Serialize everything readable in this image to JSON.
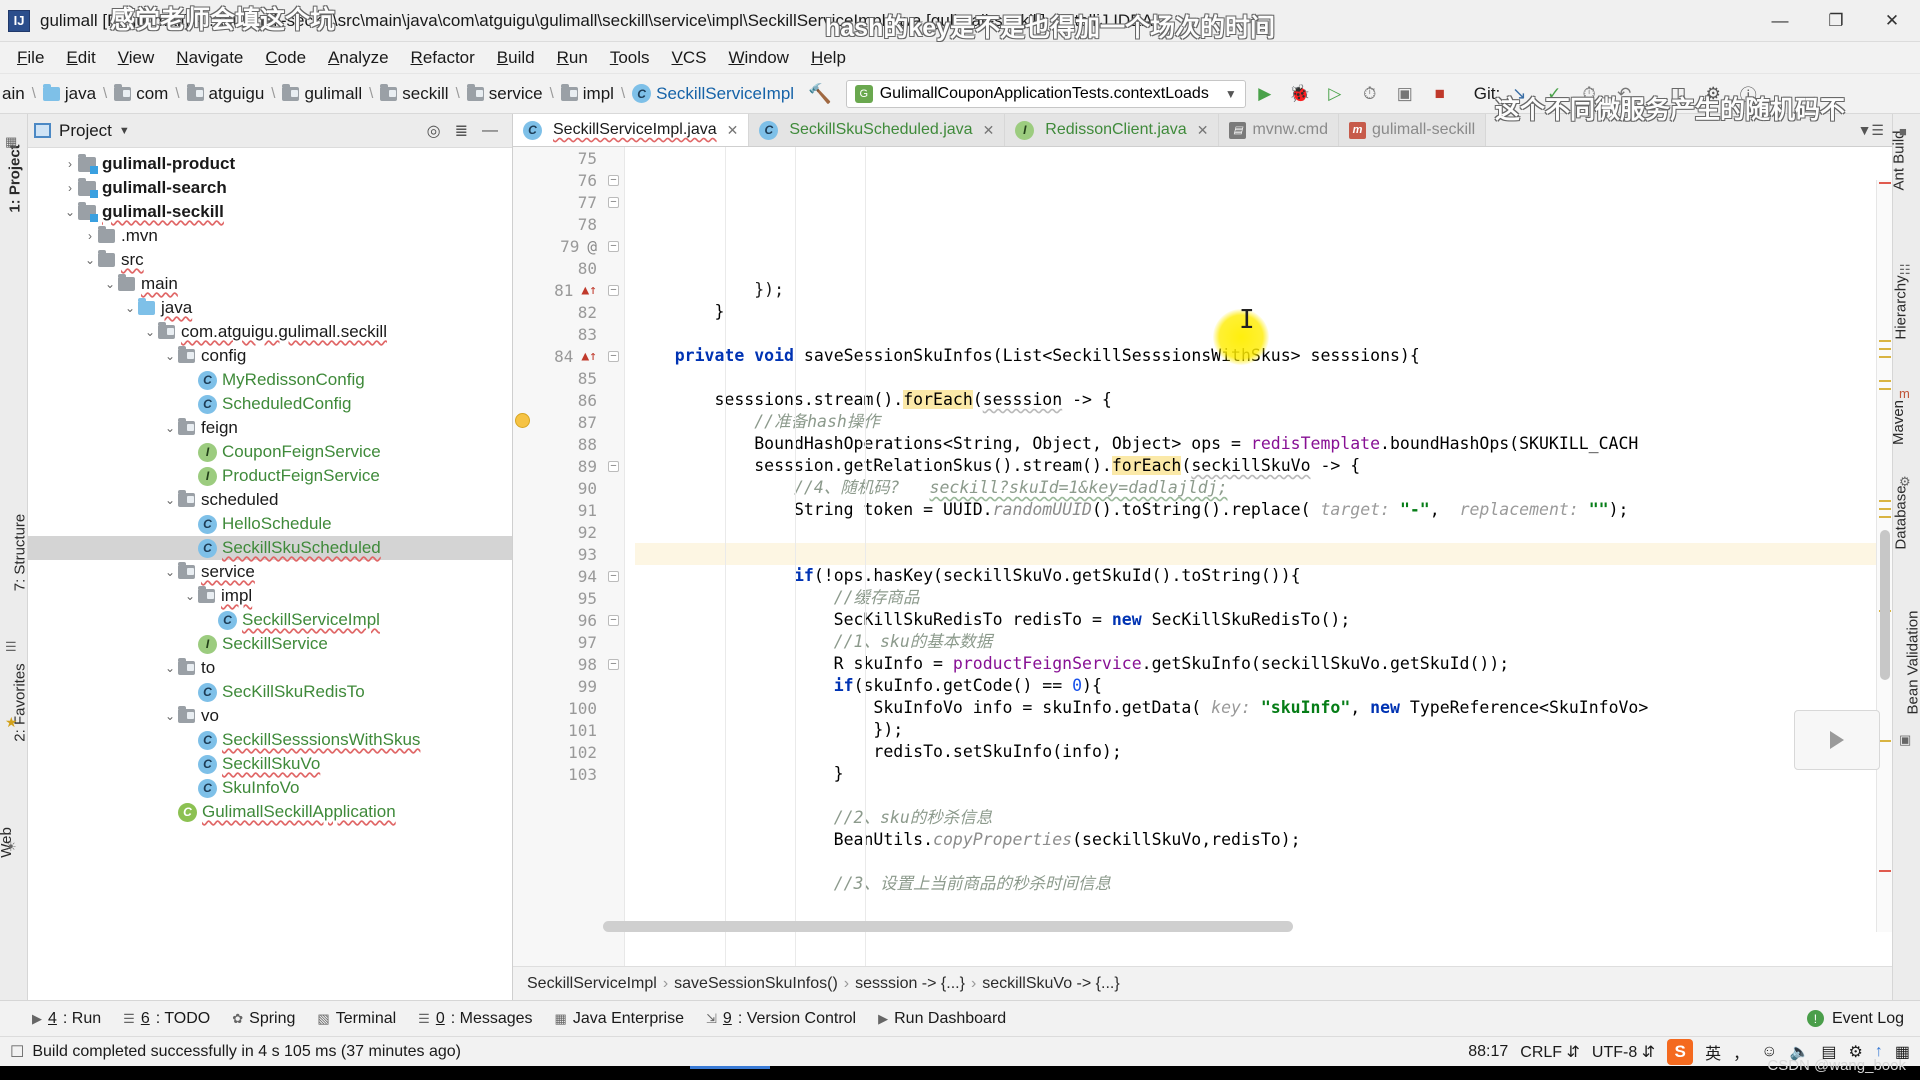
{
  "window": {
    "title": "gulimall [F:\\gulimall] - ...\\gulimall-seckill\\src\\main\\java\\com\\atguigu\\gulimall\\seckill\\service\\impl\\SeckillServiceImpl.java [gulimall-seckill] - IntelliJ IDEA",
    "app_icon": "IJ",
    "minimize": "—",
    "maximize": "❐",
    "close": "✕"
  },
  "overlay": {
    "line1": "感觉老师会填这个坑",
    "line2": "hash的key是不是也得加一个场次的时间",
    "line3": "这个不同微服务产生的随机码不",
    "watermark": "CSDN @wang_book"
  },
  "menu": [
    "File",
    "Edit",
    "View",
    "Navigate",
    "Code",
    "Analyze",
    "Refactor",
    "Build",
    "Run",
    "Tools",
    "VCS",
    "Window",
    "Help"
  ],
  "navbar": {
    "breadcrumbs": [
      {
        "label": "ain",
        "icon": "none"
      },
      {
        "label": "java",
        "icon": "folder-blue"
      },
      {
        "label": "com",
        "icon": "folder-grey"
      },
      {
        "label": "atguigu",
        "icon": "folder-grey"
      },
      {
        "label": "gulimall",
        "icon": "folder-grey"
      },
      {
        "label": "seckill",
        "icon": "folder-grey"
      },
      {
        "label": "service",
        "icon": "folder-grey"
      },
      {
        "label": "impl",
        "icon": "folder-grey"
      },
      {
        "label": "SeckillServiceImpl",
        "icon": "class"
      }
    ],
    "run_config": "GulimallCouponApplicationTests.contextLoads",
    "git_label": "Git:",
    "build_icon": "build-hammer-icon"
  },
  "left_strip": [
    "1: Project",
    "7: Structure",
    "2: Favorites",
    "Web"
  ],
  "right_strip": [
    "Ant Build",
    "Hierarchy",
    "Maven",
    "Database",
    "Bean Validation"
  ],
  "project_panel": {
    "title": "Project",
    "tree": [
      {
        "depth": 1,
        "arrow": "›",
        "icon": "module",
        "label": "gulimall-product",
        "style": "bold-dark",
        "selected": false
      },
      {
        "depth": 1,
        "arrow": "›",
        "icon": "module",
        "label": "gulimall-search",
        "style": "bold-dark",
        "selected": false
      },
      {
        "depth": 1,
        "arrow": "⌄",
        "icon": "module",
        "label": "gulimall-seckill",
        "style": "bold-dark-squiggle",
        "selected": false
      },
      {
        "depth": 2,
        "arrow": "›",
        "icon": "folder-grey",
        "label": ".mvn",
        "style": "dark",
        "selected": false
      },
      {
        "depth": 2,
        "arrow": "⌄",
        "icon": "folder-grey",
        "label": "src",
        "style": "dark-squiggle",
        "selected": false
      },
      {
        "depth": 3,
        "arrow": "⌄",
        "icon": "folder-grey",
        "label": "main",
        "style": "dark-squiggle",
        "selected": false
      },
      {
        "depth": 4,
        "arrow": "⌄",
        "icon": "folder-blue",
        "label": "java",
        "style": "dark-squiggle",
        "selected": false
      },
      {
        "depth": 5,
        "arrow": "⌄",
        "icon": "package",
        "label": "com.atguigu.gulimall.seckill",
        "style": "dark-squiggle",
        "selected": false
      },
      {
        "depth": 6,
        "arrow": "⌄",
        "icon": "package",
        "label": "config",
        "style": "dark",
        "selected": false
      },
      {
        "depth": 7,
        "arrow": "",
        "icon": "class",
        "label": "MyRedissonConfig",
        "style": "green",
        "selected": false
      },
      {
        "depth": 7,
        "arrow": "",
        "icon": "class",
        "label": "ScheduledConfig",
        "style": "green",
        "selected": false
      },
      {
        "depth": 6,
        "arrow": "⌄",
        "icon": "package",
        "label": "feign",
        "style": "dark",
        "selected": false
      },
      {
        "depth": 7,
        "arrow": "",
        "icon": "interface",
        "label": "CouponFeignService",
        "style": "green",
        "selected": false
      },
      {
        "depth": 7,
        "arrow": "",
        "icon": "interface",
        "label": "ProductFeignService",
        "style": "green",
        "selected": false
      },
      {
        "depth": 6,
        "arrow": "⌄",
        "icon": "package",
        "label": "scheduled",
        "style": "dark",
        "selected": false
      },
      {
        "depth": 7,
        "arrow": "",
        "icon": "class",
        "label": "HelloSchedule",
        "style": "green",
        "selected": false
      },
      {
        "depth": 7,
        "arrow": "",
        "icon": "class",
        "label": "SeckillSkuScheduled",
        "style": "green-squiggle",
        "selected": true
      },
      {
        "depth": 6,
        "arrow": "⌄",
        "icon": "package",
        "label": "service",
        "style": "dark-squiggle",
        "selected": false
      },
      {
        "depth": 7,
        "arrow": "⌄",
        "icon": "package",
        "label": "impl",
        "style": "dark-squiggle",
        "selected": false
      },
      {
        "depth": 8,
        "arrow": "",
        "icon": "class",
        "label": "SeckillServiceImpl",
        "style": "green-squiggle",
        "selected": false
      },
      {
        "depth": 7,
        "arrow": "",
        "icon": "interface",
        "label": "SeckillService",
        "style": "green",
        "selected": false
      },
      {
        "depth": 6,
        "arrow": "⌄",
        "icon": "package",
        "label": "to",
        "style": "dark",
        "selected": false
      },
      {
        "depth": 7,
        "arrow": "",
        "icon": "class",
        "label": "SecKillSkuRedisTo",
        "style": "green",
        "selected": false
      },
      {
        "depth": 6,
        "arrow": "⌄",
        "icon": "package",
        "label": "vo",
        "style": "dark",
        "selected": false
      },
      {
        "depth": 7,
        "arrow": "",
        "icon": "class",
        "label": "SeckillSesssionsWithSkus",
        "style": "green-squiggle",
        "selected": false
      },
      {
        "depth": 7,
        "arrow": "",
        "icon": "class",
        "label": "SeckillSkuVo",
        "style": "green-squiggle",
        "selected": false
      },
      {
        "depth": 7,
        "arrow": "",
        "icon": "class",
        "label": "SkuInfoVo",
        "style": "green",
        "selected": false
      },
      {
        "depth": 6,
        "arrow": "",
        "icon": "class-spring",
        "label": "GulimallSeckillApplication",
        "style": "green-squiggle",
        "selected": false
      }
    ]
  },
  "editor": {
    "tabs": [
      {
        "label": "SeckillServiceImpl.java",
        "icon": "class",
        "active": true,
        "closable": true,
        "squiggle": true
      },
      {
        "label": "SeckillSkuScheduled.java",
        "icon": "class",
        "active": false,
        "closable": true,
        "squiggle": false
      },
      {
        "label": "RedissonClient.java",
        "icon": "interface",
        "active": false,
        "closable": true,
        "squiggle": false
      },
      {
        "label": "mvnw.cmd",
        "icon": "maven",
        "active": false,
        "closable": false,
        "squiggle": false
      },
      {
        "label": "gulimall-seckill",
        "icon": "maven-m",
        "active": false,
        "closable": false,
        "squiggle": false
      }
    ],
    "first_line_number": 75,
    "lines": [
      {
        "n": 75,
        "fold": "",
        "gutter": "",
        "html": "",
        "highlight": false
      },
      {
        "n": 76,
        "fold": "minus",
        "gutter": "",
        "html": "            <span class=\"dk\">});</span>",
        "highlight": false
      },
      {
        "n": 77,
        "fold": "minus",
        "gutter": "",
        "html": "        }",
        "highlight": false
      },
      {
        "n": 78,
        "fold": "",
        "gutter": "",
        "html": "",
        "highlight": false
      },
      {
        "n": 79,
        "fold": "minus",
        "gutter": "@",
        "html": "    <span class=\"kw\">private void</span> saveSessionSkuInfos(List&lt;SeckillSesssionsWithSkus&gt; sesssions){",
        "highlight": false
      },
      {
        "n": 80,
        "fold": "",
        "gutter": "",
        "html": "",
        "highlight": false
      },
      {
        "n": 81,
        "fold": "minus",
        "gutter": "warn",
        "html": "        sesssions.stream().<span class=\"mhl\">forEach</span>(<span class=\"squig2\">sesssion</span> -&gt; {",
        "highlight": false
      },
      {
        "n": 82,
        "fold": "",
        "gutter": "",
        "html": "            <span class=\"cmt2\">//准备hash操作</span>",
        "highlight": false
      },
      {
        "n": 83,
        "fold": "",
        "gutter": "",
        "html": "            BoundHashOperations&lt;String, Object, Object&gt; ops = <span class=\"fld\">redisTemplate</span>.boundHashOps(SKUKILL_CACH",
        "highlight": false
      },
      {
        "n": 84,
        "fold": "minus",
        "gutter": "warn",
        "html": "            sesssion.getRelationSkus().stream().<span class=\"mhl\">forEach</span>(<span class=\"squig2\">seckillSkuVo</span> -&gt; {",
        "highlight": false
      },
      {
        "n": 85,
        "fold": "",
        "gutter": "",
        "html": "                <span class=\"cmt2\">//4、随机码?</span>   <span class=\"cmt2 sq-green\">seckill?skuId=1&amp;key=dadlajldj;</span>",
        "highlight": false
      },
      {
        "n": 86,
        "fold": "",
        "gutter": "",
        "html": "                String token = UUID.<span class=\"cmt\">randomUUID</span>().toString().replace( <span class=\"hint\">target:</span> <span class=\"str\">\"-\"</span>,  <span class=\"hint\">replacement:</span> <span class=\"str\">\"\"</span>);",
        "highlight": false
      },
      {
        "n": 87,
        "fold": "",
        "gutter": "",
        "html": "",
        "highlight": false
      },
      {
        "n": 88,
        "fold": "",
        "gutter": "bulb",
        "html": "",
        "highlight": true
      },
      {
        "n": 89,
        "fold": "minus",
        "gutter": "",
        "html": "                <span class=\"kw\">if</span>(!ops.hasKey(seckillSkuVo.getSkuId().toString()){",
        "highlight": false
      },
      {
        "n": 90,
        "fold": "",
        "gutter": "",
        "html": "                    <span class=\"cmt2\">//缓存商品</span>",
        "highlight": false
      },
      {
        "n": 91,
        "fold": "",
        "gutter": "",
        "html": "                    SecKillSkuRedisTo redisTo = <span class=\"kw\">new</span> SecKillSkuRedisTo();",
        "highlight": false
      },
      {
        "n": 92,
        "fold": "",
        "gutter": "",
        "html": "                    <span class=\"cmt2\">//1、sku的基本数据</span>",
        "highlight": false
      },
      {
        "n": 93,
        "fold": "",
        "gutter": "",
        "html": "                    R skuInfo = <span class=\"fld\">productFeignService</span>.getSkuInfo(seckillSkuVo.getSkuId());",
        "highlight": false
      },
      {
        "n": 94,
        "fold": "minus",
        "gutter": "",
        "html": "                    <span class=\"kw\">if</span>(skuInfo.getCode() == <span class=\"num\">0</span>){",
        "highlight": false
      },
      {
        "n": 95,
        "fold": "",
        "gutter": "",
        "html": "                        SkuInfoVo info = skuInfo.getData( <span class=\"hint\">key:</span> <span class=\"str\">\"skuInfo\"</span>, <span class=\"kw\">new</span> TypeReference&lt;SkuInfoVo&gt;",
        "highlight": false
      },
      {
        "n": 96,
        "fold": "minus",
        "gutter": "",
        "html": "                        });",
        "highlight": false
      },
      {
        "n": 97,
        "fold": "",
        "gutter": "",
        "html": "                        redisTo.setSkuInfo(info);",
        "highlight": false
      },
      {
        "n": 98,
        "fold": "minus",
        "gutter": "",
        "html": "                    }",
        "highlight": false
      },
      {
        "n": 99,
        "fold": "",
        "gutter": "",
        "html": "",
        "highlight": false
      },
      {
        "n": 100,
        "fold": "",
        "gutter": "",
        "html": "                    <span class=\"cmt2\">//2、sku的秒杀信息</span>",
        "highlight": false
      },
      {
        "n": 101,
        "fold": "",
        "gutter": "",
        "html": "                    BeanUtils.<span class=\"cmt\">copyProperties</span>(seckillSkuVo,redisTo);",
        "highlight": false
      },
      {
        "n": 102,
        "fold": "",
        "gutter": "",
        "html": "",
        "highlight": false
      },
      {
        "n": 103,
        "fold": "",
        "gutter": "",
        "html": "                    <span class=\"cmt2\">//3、设置上当前商品的秒杀时间信息</span>",
        "highlight": false
      }
    ],
    "breadcrumb": [
      "SeckillServiceImpl",
      "saveSessionSkuInfos()",
      "sesssion -> {...}",
      "seckillSkuVo -> {...}"
    ]
  },
  "bottom_bar": {
    "items": [
      {
        "icon": "run-triangle",
        "num": "4",
        "label": ": Run"
      },
      {
        "icon": "list",
        "num": "6",
        "label": ": TODO"
      },
      {
        "icon": "spring-leaf",
        "num": "",
        "label": "Spring"
      },
      {
        "icon": "terminal",
        "num": "",
        "label": "Terminal"
      },
      {
        "icon": "messages",
        "num": "0",
        "label": ": Messages"
      },
      {
        "icon": "java-ee",
        "num": "",
        "label": "Java Enterprise"
      },
      {
        "icon": "version-control",
        "num": "9",
        "label": ": Version Control"
      },
      {
        "icon": "run-dashboard",
        "num": "",
        "label": "Run Dashboard"
      }
    ],
    "event_log": "Event Log"
  },
  "status_bar": {
    "message": "Build completed successfully in 4 s 105 ms (37 minutes ago)",
    "caret": "88:17",
    "line_sep": "CRLF",
    "encoding": "UTF-8",
    "ime_label": "英",
    "input_method_icon": "sogou-ime-icon"
  }
}
